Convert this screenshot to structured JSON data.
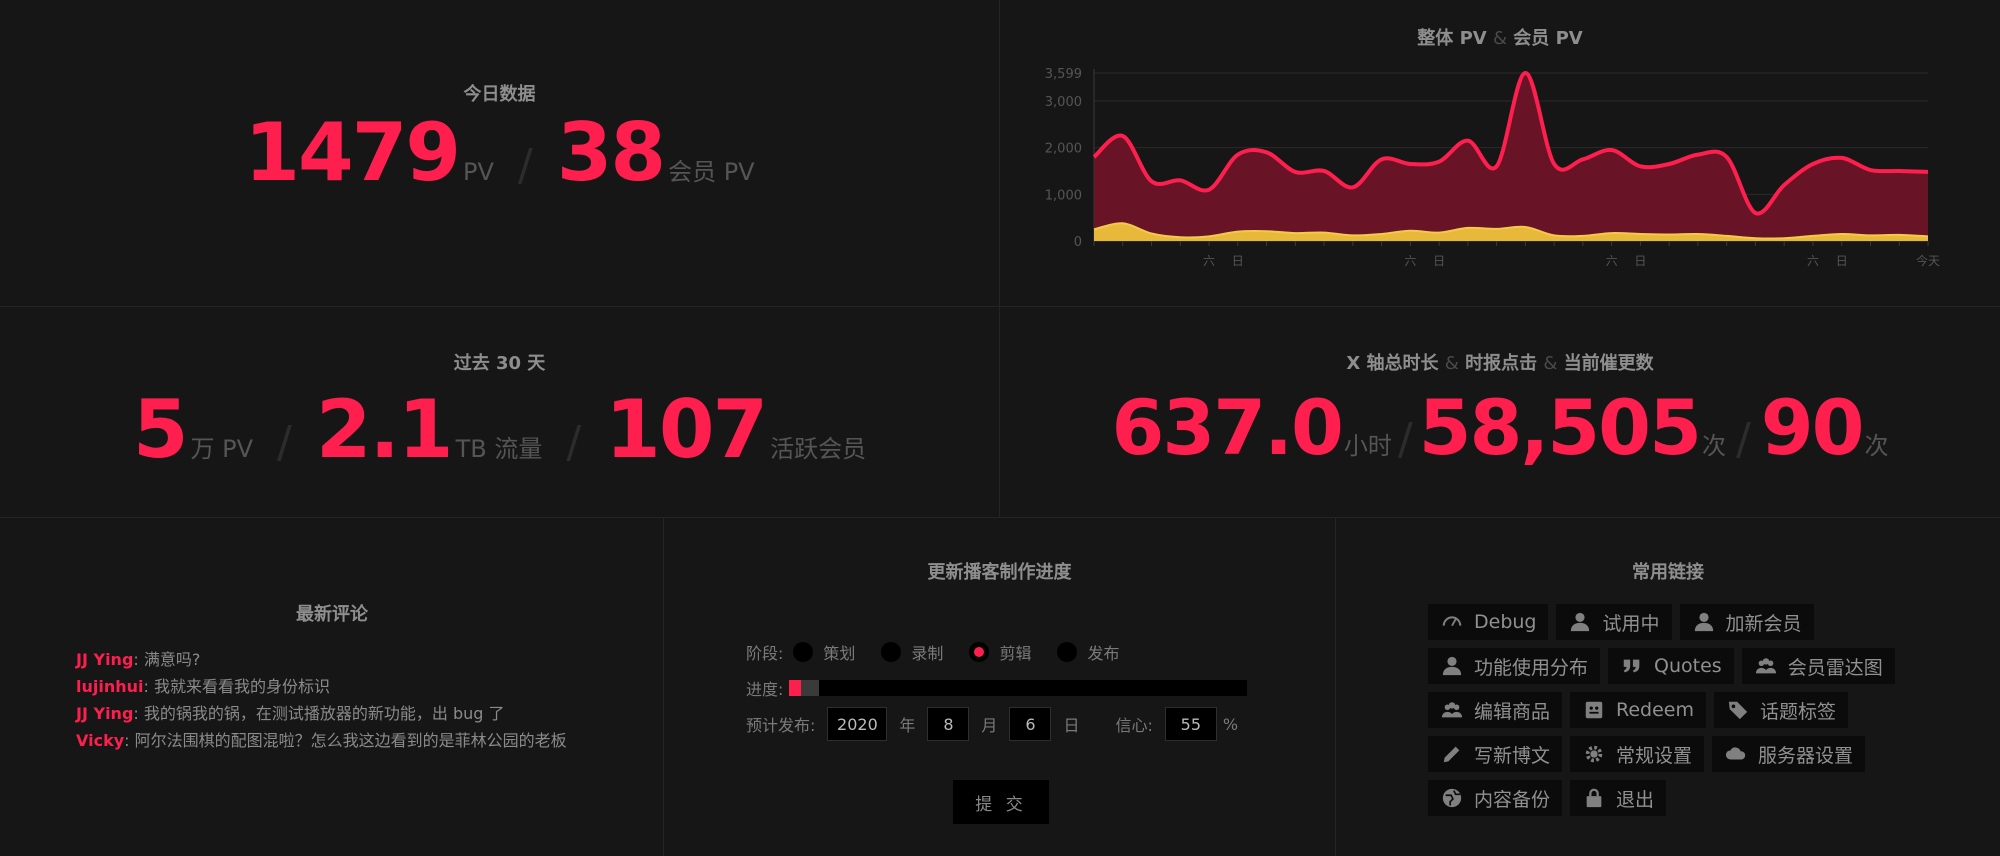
{
  "today": {
    "title": "今日数据",
    "pv": "1479",
    "pv_unit": "PV",
    "member_pv": "38",
    "member_pv_unit": "会员 PV",
    "sep": "/"
  },
  "chart": {
    "title_a": "整体 PV",
    "amp": "&",
    "title_b": "会员 PV"
  },
  "chart_data": {
    "type": "area",
    "title": "整体 PV & 会员 PV",
    "ylim": [
      0,
      3599
    ],
    "yticks": [
      "0",
      "1,000",
      "2,000",
      "3,000",
      "3,599"
    ],
    "ytick_values": [
      0,
      1000,
      2000,
      3000,
      3599
    ],
    "xlabels": [
      {
        "i": 4,
        "label": "六"
      },
      {
        "i": 5,
        "label": "日"
      },
      {
        "i": 11,
        "label": "六"
      },
      {
        "i": 12,
        "label": "日"
      },
      {
        "i": 18,
        "label": "六"
      },
      {
        "i": 19,
        "label": "日"
      },
      {
        "i": 25,
        "label": "六"
      },
      {
        "i": 26,
        "label": "日"
      },
      {
        "i": 29,
        "label": "今天"
      }
    ],
    "series": [
      {
        "name": "整体 PV",
        "color": "#ff1f4e",
        "fill": "#6e1427",
        "values": [
          1800,
          2250,
          1280,
          1300,
          1100,
          1850,
          1900,
          1480,
          1500,
          1150,
          1750,
          1650,
          1700,
          2150,
          1600,
          3599,
          1650,
          1750,
          1950,
          1600,
          1650,
          1850,
          1800,
          600,
          1200,
          1650,
          1780,
          1520,
          1500,
          1480
        ]
      },
      {
        "name": "会员 PV",
        "color": "#f2c94c",
        "fill": "#e8b83a",
        "values": [
          250,
          380,
          160,
          80,
          100,
          200,
          210,
          170,
          180,
          120,
          150,
          220,
          180,
          280,
          260,
          300,
          120,
          110,
          170,
          150,
          140,
          150,
          110,
          60,
          60,
          110,
          150,
          120,
          130,
          100
        ]
      }
    ]
  },
  "last30": {
    "title": "过去 30 天",
    "pv": "5",
    "pv_unit": "万 PV",
    "traffic": "2.1",
    "traffic_unit": "TB 流量",
    "active": "107",
    "active_unit": "活跃会员",
    "sep": "/"
  },
  "xstats": {
    "title_a": "X 轴总时长",
    "amp": "&",
    "title_b": "时报点击",
    "title_c": "当前催更数",
    "duration": "637.0",
    "duration_unit": "小时",
    "clicks": "58,505",
    "clicks_unit": "次",
    "urges": "90",
    "urges_unit": "次",
    "sep": "/"
  },
  "comments": {
    "title": "最新评论",
    "items": [
      {
        "author": "JJ Ying",
        "text": ": 满意吗?"
      },
      {
        "author": "lujinhui",
        "text": ": 我就来看看我的身份标识"
      },
      {
        "author": "JJ Ying",
        "text": ": 我的锅我的锅，在测试播放器的新功能，出 bug 了"
      },
      {
        "author": "Vicky",
        "text": ": 阿尔法围棋的配图混啦？怎么我这边看到的是菲林公园的老板"
      }
    ]
  },
  "progress": {
    "title": "更新播客制作进度",
    "stage_label": "阶段:",
    "stages": [
      "策划",
      "录制",
      "剪辑",
      "发布"
    ],
    "active_stage": 2,
    "progress_label": "进度:",
    "progress_value": 0.025,
    "buffer_value": 0.065,
    "publish_label": "预计发布:",
    "year": "2020",
    "year_unit": "年",
    "month": "8",
    "month_unit": "月",
    "day": "6",
    "day_unit": "日",
    "confidence_label": "信心:",
    "confidence": "55",
    "confidence_unit": "%",
    "submit": "提 交"
  },
  "links": {
    "title": "常用链接",
    "rows": [
      [
        {
          "label": "Debug",
          "icon": "gauge-icon"
        },
        {
          "label": "试用中",
          "icon": "user-icon"
        },
        {
          "label": "加新会员",
          "icon": "user-icon"
        }
      ],
      [
        {
          "label": "功能使用分布",
          "icon": "user-icon"
        },
        {
          "label": "Quotes",
          "icon": "quote-icon"
        },
        {
          "label": "会员雷达图",
          "icon": "users-icon"
        }
      ],
      [
        {
          "label": "编辑商品",
          "icon": "users-icon"
        },
        {
          "label": "Redeem",
          "icon": "redeem-icon"
        },
        {
          "label": "话题标签",
          "icon": "tag-icon"
        }
      ],
      [
        {
          "label": "写新博文",
          "icon": "pencil-icon"
        },
        {
          "label": "常规设置",
          "icon": "gear-icon"
        },
        {
          "label": "服务器设置",
          "icon": "cloud-icon"
        }
      ],
      [
        {
          "label": "内容备份",
          "icon": "globe-icon"
        },
        {
          "label": "退出",
          "icon": "lock-icon"
        }
      ]
    ]
  }
}
